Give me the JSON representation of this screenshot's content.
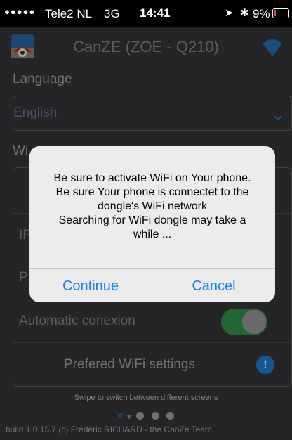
{
  "status_bar": {
    "signal": "●●●●●",
    "carrier": "Tele2 NL",
    "network": "3G",
    "time": "14:41",
    "battery": "9%"
  },
  "app_bar": {
    "title": "CanZE (ZOE - Q210)"
  },
  "settings": {
    "language_label": "Language",
    "language_value": "English",
    "wifi_label": "Wi",
    "rows": {
      "ip_label": "IP",
      "port_label": "P",
      "auto_conn_label": "Automatic conexion",
      "preferred_wifi_label": "Prefered WiFi settings",
      "info_glyph": "!"
    },
    "swipe_hint": "Swipe to switch between different screens",
    "footer": "build 1.0.15.7 (c) Frédéric RICHARD - the CanZe Team"
  },
  "dialog": {
    "message_lines": [
      "Be sure to activate WiFi on Your phone.",
      "Be sure Your phone is connectet to the",
      "dongle's WiFi network",
      "Searching for WiFi dongle may take a",
      "while ..."
    ],
    "continue_label": "Continue",
    "cancel_label": "Cancel"
  },
  "colors": {
    "accent_blue": "#1a7ff5",
    "toggle_green": "#34c759",
    "battery_red": "#ff3b30"
  }
}
